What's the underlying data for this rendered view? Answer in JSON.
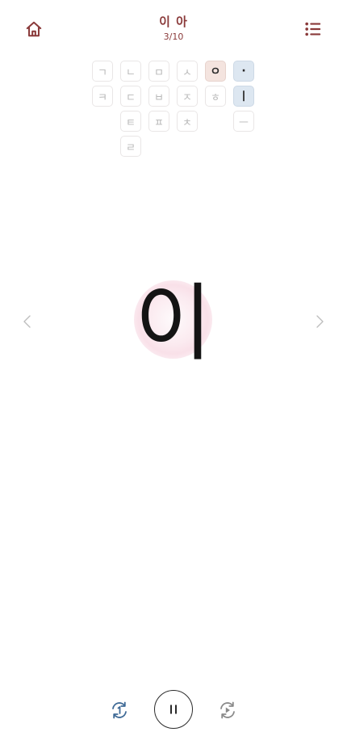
{
  "header": {
    "title": "이 아",
    "progress": "3/10",
    "home_icon": "home-icon",
    "menu_icon": "list-icon",
    "accent": "#8a3a3a"
  },
  "consonants": [
    {
      "char": "ㄱ",
      "active": false
    },
    {
      "char": "ㄴ",
      "active": false
    },
    {
      "char": "ㅁ",
      "active": false
    },
    {
      "char": "ㅅ",
      "active": false
    },
    {
      "char": "ㅇ",
      "active": true
    },
    {
      "char": "ㅋ",
      "active": false
    },
    {
      "char": "ㄷ",
      "active": false
    },
    {
      "char": "ㅂ",
      "active": false
    },
    {
      "char": "ㅈ",
      "active": false
    },
    {
      "char": "ㅎ",
      "active": false
    },
    {
      "char": "ㅌ",
      "active": false
    },
    {
      "char": "ㅍ",
      "active": false
    },
    {
      "char": "ㅊ",
      "active": false
    },
    {
      "char": "ㄹ",
      "active": false
    }
  ],
  "vowels": [
    {
      "char": "·",
      "active": true
    },
    {
      "char": "ㅣ",
      "active": true
    },
    {
      "char": "ㅡ",
      "active": false
    }
  ],
  "stage": {
    "syllable": "이",
    "prev_icon": "chevron-left-icon",
    "next_icon": "chevron-right-icon",
    "glow_color": "#eca0b9"
  },
  "controls": {
    "repeat_icon": "repeat-one-icon",
    "play_state": "playing",
    "pause_icon": "pause-icon",
    "autoplay_icon": "autoplay-icon"
  }
}
